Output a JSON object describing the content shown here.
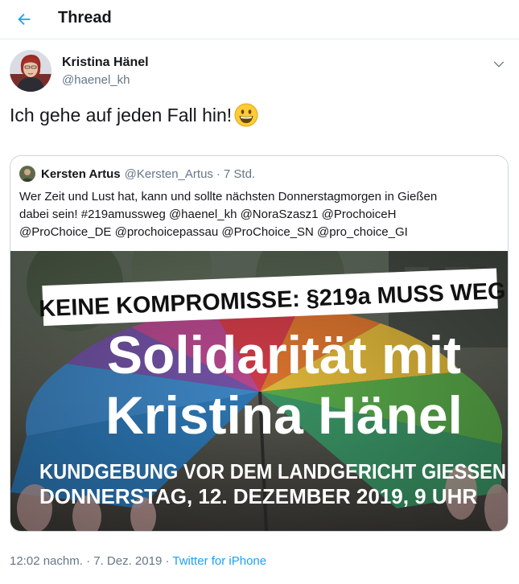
{
  "header": {
    "title": "Thread"
  },
  "tweet": {
    "author_name": "Kristina Hänel",
    "author_handle": "@haenel_kh",
    "text": "Ich gehe auf jeden Fall hin!",
    "timestamp": "12:02 nachm.",
    "separator": "·",
    "date": "7. Dez. 2019",
    "source": "Twitter for iPhone"
  },
  "quote": {
    "author_name": "Kersten Artus",
    "author_handle": "@Kersten_Artus",
    "separator": "·",
    "time": "7 Std.",
    "text_lines": [
      "Wer Zeit und Lust hat, kann und sollte nächsten Donnerstagmorgen in Gießen",
      "dabei sein! #219amussweg @haenel_kh @NoraSzasz1 @ProchoiceH",
      "@ProChoice_DE @prochoicepassau @ProChoice_SN @pro_choice_GI"
    ],
    "image": {
      "banner": "KEINE KOMPROMISSE: §219a MUSS WEG!",
      "headline_line1": "Solidarität mit",
      "headline_line2": "Kristina Hänel",
      "sub_line1": "KUNDGEBUNG VOR DEM LANDGERICHT GIESSEN",
      "sub_line2": "DONNERSTAG, 12. DEZEMBER 2019, 9 UHR"
    }
  },
  "colors": {
    "accent": "#1da1f2",
    "text": "#14171a",
    "muted": "#657786",
    "border": "#ccd6dd"
  }
}
